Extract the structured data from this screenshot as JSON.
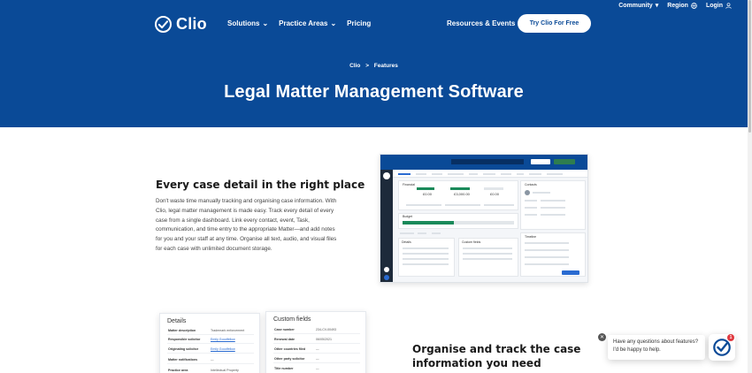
{
  "topbar": {
    "community": "Community",
    "region": "Region",
    "login": "Login"
  },
  "logo": {
    "text": "Clio"
  },
  "nav": {
    "solutions": "Solutions",
    "practice_areas": "Practice Areas",
    "pricing": "Pricing",
    "resources_events": "Resources & Events",
    "cta": "Try Clio For Free"
  },
  "breadcrumb": {
    "home": "Clio",
    "separator": ">",
    "current": "Features"
  },
  "hero": {
    "title": "Legal Matter Management Software"
  },
  "section1": {
    "title": "Every case detail in the right place",
    "body": "Don't waste time manually tracking and organising case information. With Clio, legal matter management is made easy. Track every detail of every case from a single dashboard. Link every contact, event, Task, communication, and time entry to the appropriate Matter—and add notes for you and your staff at any time. Organise all text, audio, and visual files for each case with unlimited document storage."
  },
  "app_preview": {
    "financial_label": "Financial",
    "kpi1": "£0.00",
    "kpi2": "£3,000.00",
    "kpi3": "£0.00",
    "budget_label": "Budget",
    "details_label": "Details",
    "custom_fields_label": "Custom fields",
    "contacts_label": "Contacts",
    "timeline_label": "Timeline"
  },
  "section2": {
    "details_card": {
      "title": "Details",
      "rows": [
        {
          "label": "Matter description",
          "value": "Trademark enforcement"
        },
        {
          "label": "Responsible solicitor",
          "value": "Emily Goodfellow"
        },
        {
          "label": "Originating solicitor",
          "value": "Emily Goodfellow"
        },
        {
          "label": "Matter notifications",
          "value": "—"
        },
        {
          "label": "Practice area",
          "value": "Intellectual Property"
        }
      ]
    },
    "custom_card": {
      "title": "Custom fields",
      "rows": [
        {
          "label": "Case number",
          "value": "234-CV-00493"
        },
        {
          "label": "Renewal date",
          "value": "06/05/2021"
        },
        {
          "label": "Other countries filed",
          "value": "—"
        },
        {
          "label": "Other party solicitor",
          "value": "—"
        },
        {
          "label": "Title number",
          "value": "—"
        }
      ]
    },
    "title": "Organise and track the case information you need"
  },
  "chat": {
    "message": "Have any questions about features? I'd be happy to help.",
    "badge": "1"
  },
  "colors": {
    "brand_blue": "#0a4a97",
    "accent_green": "#1a8a5a",
    "badge_red": "#e0383e"
  }
}
